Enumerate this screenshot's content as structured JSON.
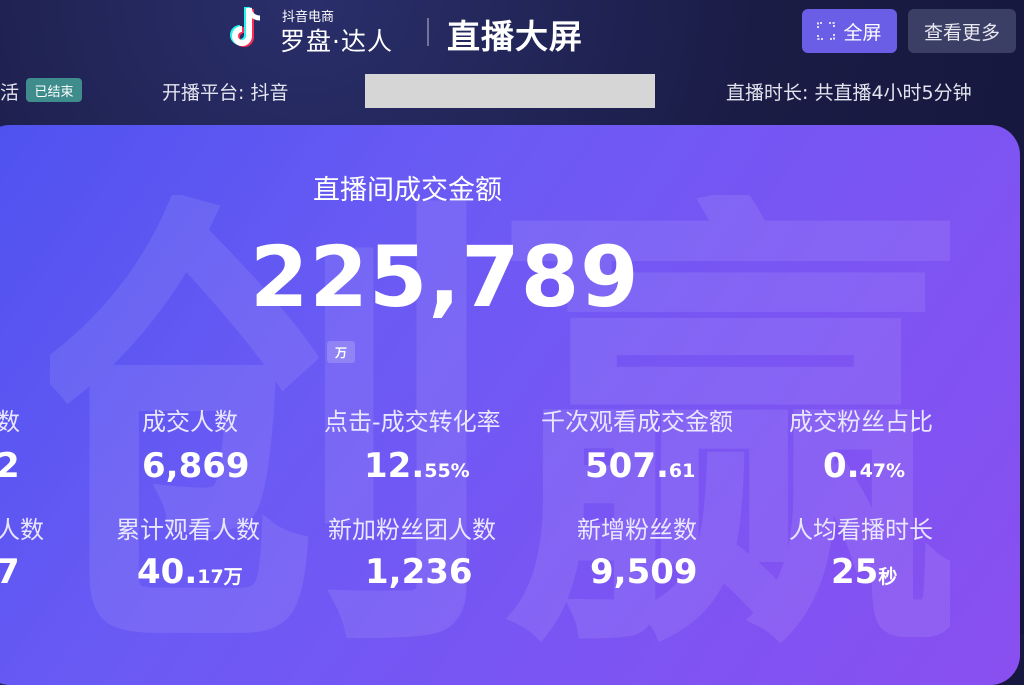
{
  "header": {
    "brand_small": "抖音电商",
    "brand_big": "罗盘·达人",
    "screen_title": "直播大屏",
    "fullscreen_label": "全屏",
    "more_label": "查看更多"
  },
  "info": {
    "left_fragment": "活",
    "status_badge": "已结束",
    "platform": "开播平台: 抖音",
    "duration": "直播时长: 共直播4小时5分钟"
  },
  "hero": {
    "label": "直播间成交金额",
    "value": "225,789",
    "unit": "万"
  },
  "metrics_row1": [
    {
      "label": "数",
      "main": "2",
      "suffix": ""
    },
    {
      "label": "成交人数",
      "main": "6,869",
      "suffix": ""
    },
    {
      "label": "点击-成交转化率",
      "main": "12.",
      "suffix": "55%"
    },
    {
      "label": "千次观看成交金额",
      "main": "507.",
      "suffix": "61"
    },
    {
      "label": "成交粉丝占比",
      "main": "0.",
      "suffix": "47%"
    }
  ],
  "metrics_row2": [
    {
      "label": "人数",
      "main": "7",
      "suffix": ""
    },
    {
      "label": "累计观看人数",
      "main": "40.",
      "suffix": "17万"
    },
    {
      "label": "新加粉丝团人数",
      "main": "1,236",
      "suffix": ""
    },
    {
      "label": "新增粉丝数",
      "main": "9,509",
      "suffix": ""
    },
    {
      "label": "人均看播时长",
      "main": "25",
      "suffix": "秒"
    }
  ],
  "watermark_text": "创赢",
  "colors": {
    "accent": "#6a5ee6",
    "badge": "#3f8c8c",
    "panel_start": "#4e52f0",
    "panel_end": "#8a4ff0"
  }
}
